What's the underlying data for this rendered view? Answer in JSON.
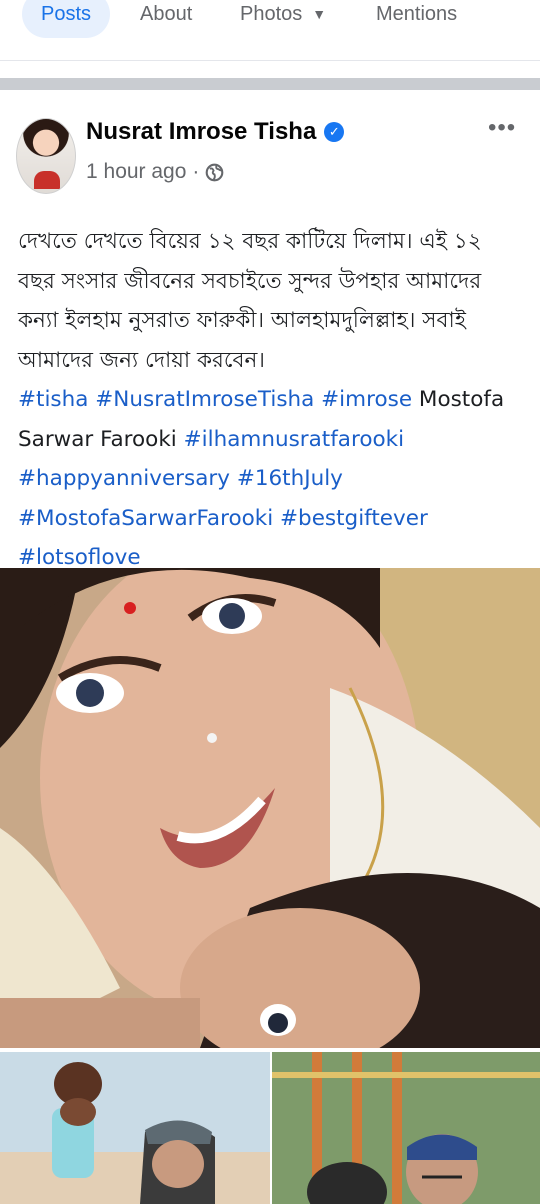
{
  "tabs": [
    {
      "label": "Posts",
      "active": true
    },
    {
      "label": "About",
      "active": false
    },
    {
      "label": "Photos",
      "active": false
    },
    {
      "label": "Mentions",
      "active": false
    }
  ],
  "post": {
    "author": "Nusrat Imrose Tisha",
    "verified_icon": "verified-badge-icon",
    "time": "1 hour ago",
    "separator": "·",
    "audience_icon": "globe-icon",
    "more_icon": "more-options-icon",
    "text_lines": [
      "দেখতে দেখতে বিয়ের ১২ বছর কাটিয়ে দিলাম। এই ১২",
      "বছর সংসার জীবনের সবচাইতে সুন্দর উপহার আমাদের",
      "কন্যা ইলহাম নুসরাত ফারুকী। আলহামদুলিল্লাহ। সবাই",
      "আমাদের জন্য দোয়া করবেন।"
    ],
    "hashtags_line1": [
      "#tisha",
      "#NusratImroseTisha",
      "#imrose"
    ],
    "mention_part1": "Mostofa",
    "mention_part2": "Sarwar Farooki",
    "hashtags_line2": [
      "#ilhamnusratfarooki"
    ],
    "hashtags_line3": [
      "#happyanniversary",
      "#16thJuly"
    ],
    "hashtags_line4": [
      "#MostofaSarwarFarooki",
      "#bestgiftever",
      "#lotsoflove"
    ]
  },
  "colors": {
    "link": "#1a5ec8",
    "accent": "#1877f2",
    "muted": "#65676b"
  }
}
